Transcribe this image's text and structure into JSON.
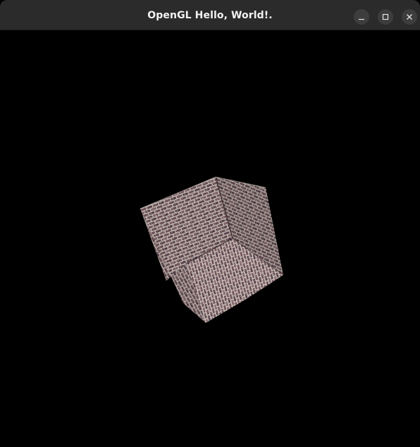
{
  "window": {
    "title": "OpenGL Hello, World!.",
    "controls": {
      "minimize_icon": "minimize-icon",
      "maximize_icon": "maximize-icon",
      "close_icon": "close-icon"
    }
  },
  "scene": {
    "background_color": "#000000",
    "object": "textured-cube",
    "texture": "brick",
    "texture_colors": {
      "brick": "#6e5058",
      "brick_light": "#a5888e",
      "mortar": "#d9cfc6",
      "shadow": "#3b2a30"
    }
  }
}
